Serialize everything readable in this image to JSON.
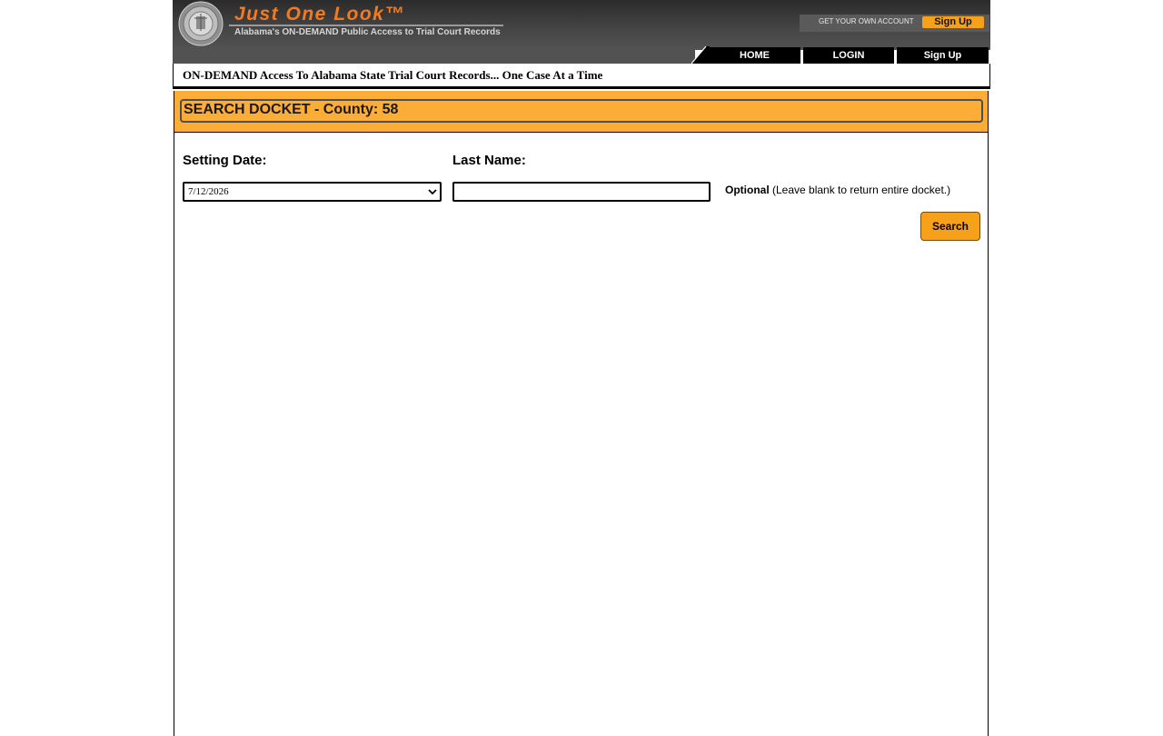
{
  "header": {
    "logo_title": "Just One Look™",
    "logo_subtitle": "Alabama's ON-DEMAND Public Access to Trial Court Records",
    "account_prompt": "GET YOUR OWN ACCOUNT",
    "account_signup_label": "Sign Up"
  },
  "nav": {
    "items": [
      {
        "label": "HOME"
      },
      {
        "label": "LOGIN"
      },
      {
        "label": "Sign Up"
      }
    ]
  },
  "tagline": "ON-DEMAND Access To Alabama State Trial Court Records... One Case At a Time",
  "search": {
    "title": "SEARCH DOCKET - County: 58",
    "setting_date_label": "Setting Date:",
    "setting_date_value": "7/12/2026",
    "last_name_label": "Last Name:",
    "last_name_value": "",
    "optional_bold": "Optional",
    "optional_note": " (Leave blank to return entire docket.)",
    "search_button_label": "Search"
  },
  "colors": {
    "header_dark": "#2b2b2b",
    "accent_orange": "#f47a20",
    "title_band": "#fbad37",
    "button_orange": "#f7a01a"
  }
}
